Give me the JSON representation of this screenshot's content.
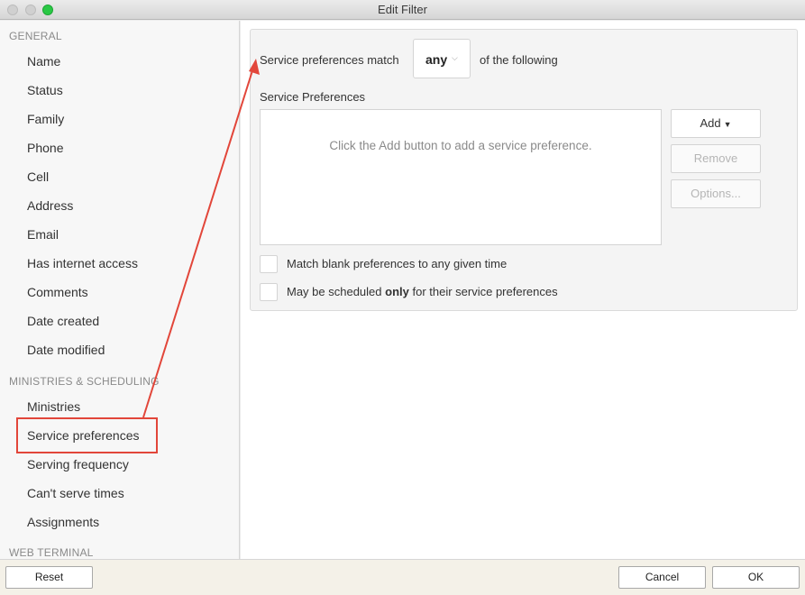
{
  "window": {
    "title": "Edit Filter"
  },
  "sidebar": {
    "sections": [
      {
        "header": "GENERAL",
        "items": [
          "Name",
          "Status",
          "Family",
          "Phone",
          "Cell",
          "Address",
          "Email",
          "Has internet access",
          "Comments",
          "Date created",
          "Date modified"
        ]
      },
      {
        "header": "MINISTRIES & SCHEDULING",
        "items": [
          "Ministries",
          "Service preferences",
          "Serving frequency",
          "Can't serve times",
          "Assignments"
        ]
      },
      {
        "header": "WEB TERMINAL",
        "items": []
      }
    ],
    "selected": "Service preferences"
  },
  "main": {
    "match_label": "Service preferences match",
    "match_value": "any",
    "following_label": "of the following",
    "prefs_title": "Service Preferences",
    "prefs_empty": "Click the Add button to add a service preference.",
    "buttons": {
      "add": "Add",
      "remove": "Remove",
      "options": "Options..."
    },
    "checkbox1": {
      "label": "Match blank preferences to any given time",
      "checked": false
    },
    "checkbox2": {
      "label_before": "May be scheduled ",
      "label_bold": "only",
      "label_after": " for their service preferences",
      "checked": false
    }
  },
  "bottom": {
    "reset": "Reset",
    "cancel": "Cancel",
    "ok": "OK"
  },
  "colors": {
    "annotation": "#e2463a",
    "maximize": "#2ac845"
  }
}
